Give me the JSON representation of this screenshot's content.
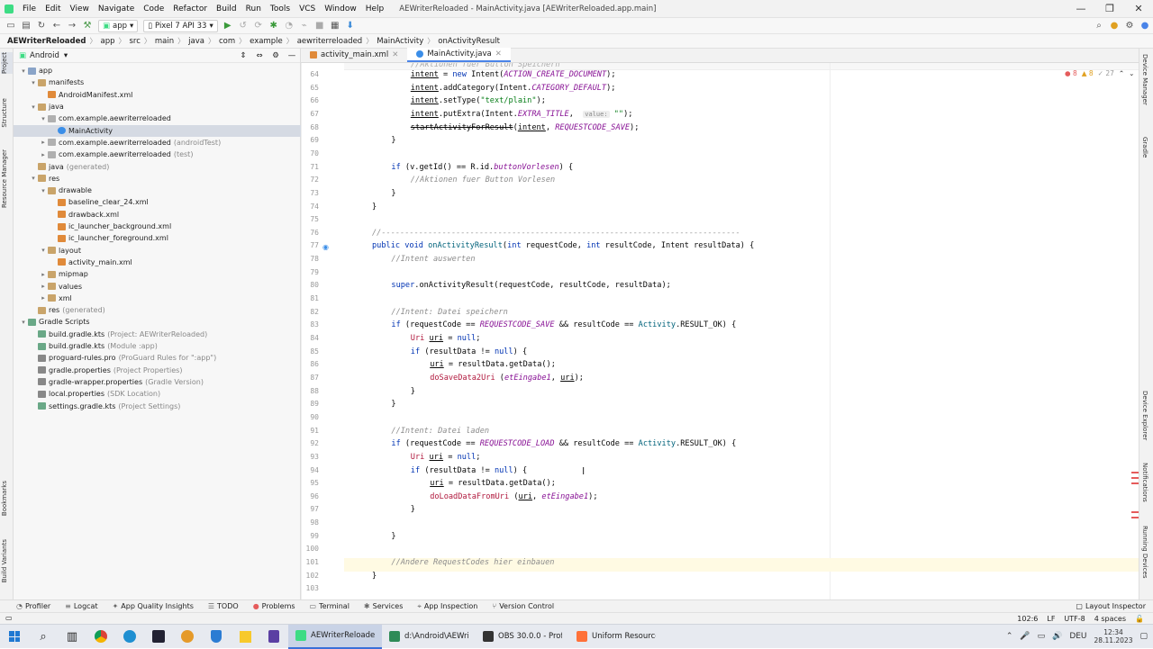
{
  "window": {
    "title": "AEWriterReloaded - MainActivity.java [AEWriterReloaded.app.main]",
    "menu": [
      "File",
      "Edit",
      "View",
      "Navigate",
      "Code",
      "Refactor",
      "Build",
      "Run",
      "Tools",
      "VCS",
      "Window",
      "Help"
    ]
  },
  "toolbar": {
    "run_config": "app",
    "device": "Pixel 7 API 33"
  },
  "breadcrumb": [
    "AEWriterReloaded",
    "app",
    "src",
    "main",
    "java",
    "com",
    "example",
    "aewriterreloaded",
    "MainActivity",
    "onActivityResult"
  ],
  "left_stripe": [
    "Project",
    "Structure",
    "Resource Manager",
    "Bookmarks",
    "Build Variants"
  ],
  "project": {
    "view": "Android",
    "tree": [
      {
        "label": "app",
        "note": "",
        "indent": 0,
        "twisty": "▾",
        "icon": "mfolder"
      },
      {
        "label": "manifests",
        "note": "",
        "indent": 1,
        "twisty": "▾",
        "icon": "folder"
      },
      {
        "label": "AndroidManifest.xml",
        "note": "",
        "indent": 2,
        "twisty": "",
        "icon": "xmlf"
      },
      {
        "label": "java",
        "note": "",
        "indent": 1,
        "twisty": "▾",
        "icon": "folder"
      },
      {
        "label": "com.example.aewriterreloaded",
        "note": "",
        "indent": 2,
        "twisty": "▾",
        "icon": "pkg"
      },
      {
        "label": "MainActivity",
        "note": "",
        "indent": 3,
        "twisty": "",
        "icon": "cls",
        "selected": true
      },
      {
        "label": "com.example.aewriterreloaded",
        "note": "(androidTest)",
        "indent": 2,
        "twisty": "▸",
        "icon": "pkg"
      },
      {
        "label": "com.example.aewriterreloaded",
        "note": "(test)",
        "indent": 2,
        "twisty": "▸",
        "icon": "pkg"
      },
      {
        "label": "java",
        "note": "(generated)",
        "indent": 1,
        "twisty": "",
        "icon": "folder"
      },
      {
        "label": "res",
        "note": "",
        "indent": 1,
        "twisty": "▾",
        "icon": "folder"
      },
      {
        "label": "drawable",
        "note": "",
        "indent": 2,
        "twisty": "▾",
        "icon": "folder"
      },
      {
        "label": "baseline_clear_24.xml",
        "note": "",
        "indent": 3,
        "twisty": "",
        "icon": "xmlf"
      },
      {
        "label": "drawback.xml",
        "note": "",
        "indent": 3,
        "twisty": "",
        "icon": "xmlf"
      },
      {
        "label": "ic_launcher_background.xml",
        "note": "",
        "indent": 3,
        "twisty": "",
        "icon": "xmlf"
      },
      {
        "label": "ic_launcher_foreground.xml",
        "note": "",
        "indent": 3,
        "twisty": "",
        "icon": "xmlf"
      },
      {
        "label": "layout",
        "note": "",
        "indent": 2,
        "twisty": "▾",
        "icon": "folder"
      },
      {
        "label": "activity_main.xml",
        "note": "",
        "indent": 3,
        "twisty": "",
        "icon": "xmlf"
      },
      {
        "label": "mipmap",
        "note": "",
        "indent": 2,
        "twisty": "▸",
        "icon": "folder"
      },
      {
        "label": "values",
        "note": "",
        "indent": 2,
        "twisty": "▸",
        "icon": "folder"
      },
      {
        "label": "xml",
        "note": "",
        "indent": 2,
        "twisty": "▸",
        "icon": "folder"
      },
      {
        "label": "res",
        "note": "(generated)",
        "indent": 1,
        "twisty": "",
        "icon": "folder"
      },
      {
        "label": "Gradle Scripts",
        "note": "",
        "indent": 0,
        "twisty": "▾",
        "icon": "gradle"
      },
      {
        "label": "build.gradle.kts",
        "note": "(Project: AEWriterReloaded)",
        "indent": 1,
        "twisty": "",
        "icon": "gradle"
      },
      {
        "label": "build.gradle.kts",
        "note": "(Module :app)",
        "indent": 1,
        "twisty": "",
        "icon": "gradle"
      },
      {
        "label": "proguard-rules.pro",
        "note": "(ProGuard Rules for \":app\")",
        "indent": 1,
        "twisty": "",
        "icon": "prop"
      },
      {
        "label": "gradle.properties",
        "note": "(Project Properties)",
        "indent": 1,
        "twisty": "",
        "icon": "prop"
      },
      {
        "label": "gradle-wrapper.properties",
        "note": "(Gradle Version)",
        "indent": 1,
        "twisty": "",
        "icon": "prop"
      },
      {
        "label": "local.properties",
        "note": "(SDK Location)",
        "indent": 1,
        "twisty": "",
        "icon": "prop"
      },
      {
        "label": "settings.gradle.kts",
        "note": "(Project Settings)",
        "indent": 1,
        "twisty": "",
        "icon": "gradle"
      }
    ]
  },
  "editor": {
    "tabs": [
      {
        "label": "activity_main.xml",
        "active": false
      },
      {
        "label": "MainActivity.java",
        "active": true
      }
    ],
    "inspections": {
      "errors": "8",
      "warnings": "8",
      "weak": "27"
    },
    "lines": [
      {
        "n": "64",
        "indent": 4,
        "tokens": [
          [
            "v",
            "intent"
          ],
          [
            "p",
            " = "
          ],
          [
            "kw",
            "new"
          ],
          [
            "p",
            " Intent("
          ],
          [
            "cs",
            "ACTION_CREATE_DOCUMENT"
          ],
          [
            "p",
            ");"
          ]
        ]
      },
      {
        "n": "65",
        "indent": 4,
        "tokens": [
          [
            "v",
            "intent"
          ],
          [
            "p",
            ".addCategory(Intent."
          ],
          [
            "cs",
            "CATEGORY_DEFAULT"
          ],
          [
            "p",
            ");"
          ]
        ]
      },
      {
        "n": "66",
        "indent": 4,
        "tokens": [
          [
            "v",
            "intent"
          ],
          [
            "p",
            ".setType("
          ],
          [
            "st",
            "\"text/plain\""
          ],
          [
            "p",
            ");"
          ]
        ]
      },
      {
        "n": "67",
        "indent": 4,
        "tokens": [
          [
            "v",
            "intent"
          ],
          [
            "p",
            ".putExtra(Intent."
          ],
          [
            "cs",
            "EXTRA_TITLE"
          ],
          [
            "p",
            ",  "
          ],
          [
            "hint",
            "value:"
          ],
          [
            "st",
            " \"\""
          ],
          [
            "p",
            ");"
          ]
        ]
      },
      {
        "n": "68",
        "indent": 4,
        "tokens": [
          [
            "strike",
            "startActivityForResult"
          ],
          [
            "p",
            "("
          ],
          [
            "v",
            "intent"
          ],
          [
            "p",
            ", "
          ],
          [
            "cs",
            "REQUESTCODE_SAVE"
          ],
          [
            "p",
            ");"
          ]
        ]
      },
      {
        "n": "69",
        "indent": 2,
        "tokens": [
          [
            "p",
            "}"
          ]
        ]
      },
      {
        "n": "70",
        "indent": 0,
        "tokens": []
      },
      {
        "n": "71",
        "indent": 2,
        "tokens": [
          [
            "kw",
            "if"
          ],
          [
            "p",
            " (v.getId() == R.id."
          ],
          [
            "cs",
            "buttonVorlesen"
          ],
          [
            "p",
            ") {"
          ]
        ]
      },
      {
        "n": "72",
        "indent": 4,
        "tokens": [
          [
            "cm",
            "//Aktionen fuer Button Vorlesen"
          ]
        ]
      },
      {
        "n": "73",
        "indent": 2,
        "tokens": [
          [
            "p",
            "}"
          ]
        ]
      },
      {
        "n": "74",
        "indent": 0,
        "tokens": [
          [
            "p",
            "}"
          ]
        ]
      },
      {
        "n": "75",
        "indent": 0,
        "tokens": []
      },
      {
        "n": "76",
        "indent": 0,
        "tokens": [
          [
            "cm",
            "//-----------------------------------------------------------------------------"
          ]
        ]
      },
      {
        "n": "77",
        "indent": 0,
        "tokens": [
          [
            "kw",
            "public void"
          ],
          [
            "p",
            " "
          ],
          [
            "fn",
            "onActivityResult"
          ],
          [
            "p",
            "("
          ],
          [
            "kw",
            "int"
          ],
          [
            "p",
            " requestCode, "
          ],
          [
            "kw",
            "int"
          ],
          [
            "p",
            " resultCode, Intent resultData) {"
          ]
        ]
      },
      {
        "n": "78",
        "indent": 2,
        "tokens": [
          [
            "cm",
            "//Intent auswerten"
          ]
        ]
      },
      {
        "n": "79",
        "indent": 0,
        "tokens": []
      },
      {
        "n": "80",
        "indent": 2,
        "tokens": [
          [
            "kw",
            "super"
          ],
          [
            "p",
            ".onActivityResult(requestCode, resultCode, resultData);"
          ]
        ]
      },
      {
        "n": "81",
        "indent": 0,
        "tokens": []
      },
      {
        "n": "82",
        "indent": 2,
        "tokens": [
          [
            "cm",
            "//Intent: Datei speichern"
          ]
        ]
      },
      {
        "n": "83",
        "indent": 2,
        "tokens": [
          [
            "kw",
            "if"
          ],
          [
            "p",
            " (requestCode == "
          ],
          [
            "cs",
            "REQUESTCODE_SAVE"
          ],
          [
            "p",
            " && resultCode == "
          ],
          [
            "fn",
            "Activity"
          ],
          [
            "p",
            ".RESULT_OK) {"
          ]
        ]
      },
      {
        "n": "84",
        "indent": 4,
        "tokens": [
          [
            "rd",
            "Uri"
          ],
          [
            "p",
            " "
          ],
          [
            "v",
            "uri"
          ],
          [
            "p",
            " = "
          ],
          [
            "kw",
            "null"
          ],
          [
            "p",
            ";"
          ]
        ]
      },
      {
        "n": "85",
        "indent": 4,
        "tokens": [
          [
            "kw",
            "if"
          ],
          [
            "p",
            " (resultData != "
          ],
          [
            "kw",
            "null"
          ],
          [
            "p",
            ") {"
          ]
        ]
      },
      {
        "n": "86",
        "indent": 6,
        "tokens": [
          [
            "v",
            "uri"
          ],
          [
            "p",
            " = resultData.getData();"
          ]
        ]
      },
      {
        "n": "87",
        "indent": 6,
        "tokens": [
          [
            "rd",
            "doSaveData2Uri"
          ],
          [
            "p",
            " ("
          ],
          [
            "cs",
            "etEingabe1"
          ],
          [
            "p",
            ", "
          ],
          [
            "v",
            "uri"
          ],
          [
            "p",
            ");"
          ]
        ]
      },
      {
        "n": "88",
        "indent": 4,
        "tokens": [
          [
            "p",
            "}"
          ]
        ]
      },
      {
        "n": "89",
        "indent": 2,
        "tokens": [
          [
            "p",
            "}"
          ]
        ]
      },
      {
        "n": "90",
        "indent": 0,
        "tokens": []
      },
      {
        "n": "91",
        "indent": 2,
        "tokens": [
          [
            "cm",
            "//Intent: Datei laden"
          ]
        ]
      },
      {
        "n": "92",
        "indent": 2,
        "tokens": [
          [
            "kw",
            "if"
          ],
          [
            "p",
            " (requestCode == "
          ],
          [
            "cs",
            "REQUESTCODE_LOAD"
          ],
          [
            "p",
            " && resultCode == "
          ],
          [
            "fn",
            "Activity"
          ],
          [
            "p",
            ".RESULT_OK) {"
          ]
        ]
      },
      {
        "n": "93",
        "indent": 4,
        "tokens": [
          [
            "rd",
            "Uri"
          ],
          [
            "p",
            " "
          ],
          [
            "v",
            "uri"
          ],
          [
            "p",
            " = "
          ],
          [
            "kw",
            "null"
          ],
          [
            "p",
            ";"
          ]
        ]
      },
      {
        "n": "94",
        "indent": 4,
        "tokens": [
          [
            "kw",
            "if"
          ],
          [
            "p",
            " (resultData != "
          ],
          [
            "kw",
            "null"
          ],
          [
            "p",
            ") {"
          ]
        ]
      },
      {
        "n": "95",
        "indent": 6,
        "tokens": [
          [
            "v",
            "uri"
          ],
          [
            "p",
            " = resultData.getData();"
          ]
        ]
      },
      {
        "n": "96",
        "indent": 6,
        "tokens": [
          [
            "rd",
            "doLoadDataFromUri"
          ],
          [
            "p",
            " ("
          ],
          [
            "v",
            "uri"
          ],
          [
            "p",
            ", "
          ],
          [
            "cs",
            "etEingabe1"
          ],
          [
            "p",
            ");"
          ]
        ]
      },
      {
        "n": "97",
        "indent": 4,
        "tokens": [
          [
            "p",
            "}"
          ]
        ]
      },
      {
        "n": "98",
        "indent": 0,
        "tokens": []
      },
      {
        "n": "99",
        "indent": 2,
        "tokens": [
          [
            "p",
            "}"
          ]
        ]
      },
      {
        "n": "100",
        "indent": 0,
        "tokens": []
      },
      {
        "n": "101",
        "indent": 2,
        "tokens": [
          [
            "cm",
            "//Andere RequestCodes hier einbauen"
          ]
        ]
      },
      {
        "n": "102",
        "indent": 0,
        "tokens": [
          [
            "p",
            "}"
          ]
        ]
      },
      {
        "n": "103",
        "indent": 0,
        "tokens": []
      }
    ]
  },
  "right_stripe": [
    "Device Manager",
    "Gradle",
    "Device Explorer",
    "Notifications",
    "Running Devices"
  ],
  "bottom_tabs": [
    "Profiler",
    "Logcat",
    "App Quality Insights",
    "TODO",
    "Problems",
    "Terminal",
    "Services",
    "App Inspection",
    "Version Control"
  ],
  "layout_inspector": "Layout Inspector",
  "status": {
    "position": "102:6",
    "line_sep": "LF",
    "encoding": "UTF-8",
    "indent": "4 spaces"
  },
  "taskbar": {
    "apps": [
      {
        "label": "AEWriterReloaded ...",
        "color": "#3ddc84",
        "active": true
      },
      {
        "label": "d:\\Android\\AEWrit...",
        "color": "#2e8b57",
        "active": false
      },
      {
        "label": "OBS 30.0.0 - Profil:...",
        "color": "#333333",
        "active": false
      },
      {
        "label": "Uniform Resource I...",
        "color": "#ff7139",
        "active": false
      }
    ],
    "lang": "DEU",
    "time": "12:34",
    "date": "28.11.2023"
  },
  "colors": {
    "accent": "#4a84e8",
    "error": "#e55b5b",
    "warning": "#e0a020"
  }
}
